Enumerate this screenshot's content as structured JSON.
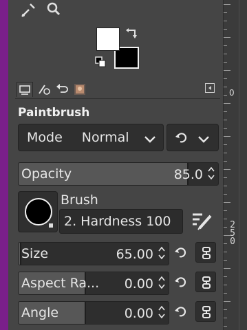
{
  "tool_options": {
    "title": "Paintbrush",
    "mode": {
      "label": "Mode",
      "value": "Normal"
    },
    "opacity": {
      "label": "Opacity",
      "value": "85.0",
      "fraction": 0.85
    },
    "brush": {
      "label": "Brush",
      "name": "2. Hardness 100"
    },
    "size": {
      "label": "Size",
      "value": "65.00",
      "fraction": 0.02
    },
    "aspect_ratio": {
      "label": "Aspect Ra...",
      "value": "0.00",
      "fraction": 0.45
    },
    "angle": {
      "label": "Angle",
      "value": "0.00",
      "fraction": 0.45
    }
  },
  "colors": {
    "foreground": "#ffffff",
    "background": "#000000",
    "accent_strip": "#7a1f8a"
  },
  "ruler": {
    "top_label": "0",
    "vertical_label": "250"
  },
  "icons": [
    "color-picker-icon",
    "zoom-icon",
    "swap-colors-icon",
    "reset-colors-icon",
    "tool-options-tab-icon",
    "device-status-tab-icon",
    "undo-history-tab-icon",
    "images-tab-icon",
    "tab-menu-icon",
    "reset-icon",
    "edit-brush-icon",
    "chain-icon"
  ]
}
